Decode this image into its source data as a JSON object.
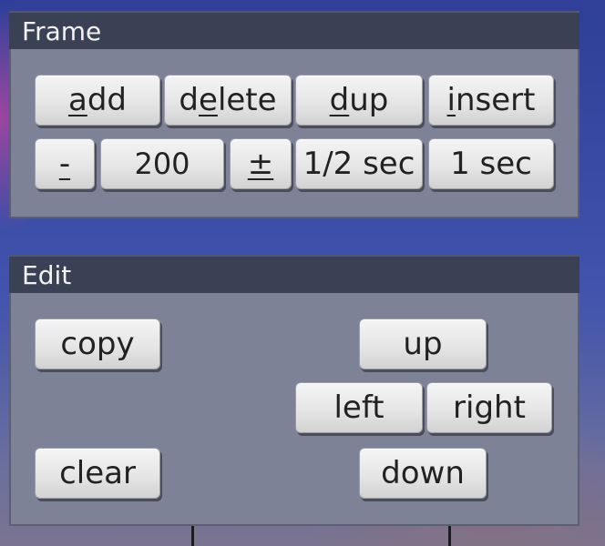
{
  "frame": {
    "title": "Frame",
    "add": {
      "pre": "",
      "key": "a",
      "post": "dd"
    },
    "delete": {
      "pre": "d",
      "key": "e",
      "post": "lete"
    },
    "dup": {
      "pre": "",
      "key": "d",
      "post": "up"
    },
    "insert": {
      "pre": "",
      "key": "i",
      "post": "nsert"
    },
    "minus_label": "-",
    "value": "200",
    "plus_label": "±",
    "half_sec_label": "1/2 sec",
    "one_sec_label": "1 sec"
  },
  "edit": {
    "title": "Edit",
    "copy_label": "copy",
    "clear_label": "clear",
    "up_label": "up",
    "left_label": "left",
    "right_label": "right",
    "down_label": "down"
  }
}
